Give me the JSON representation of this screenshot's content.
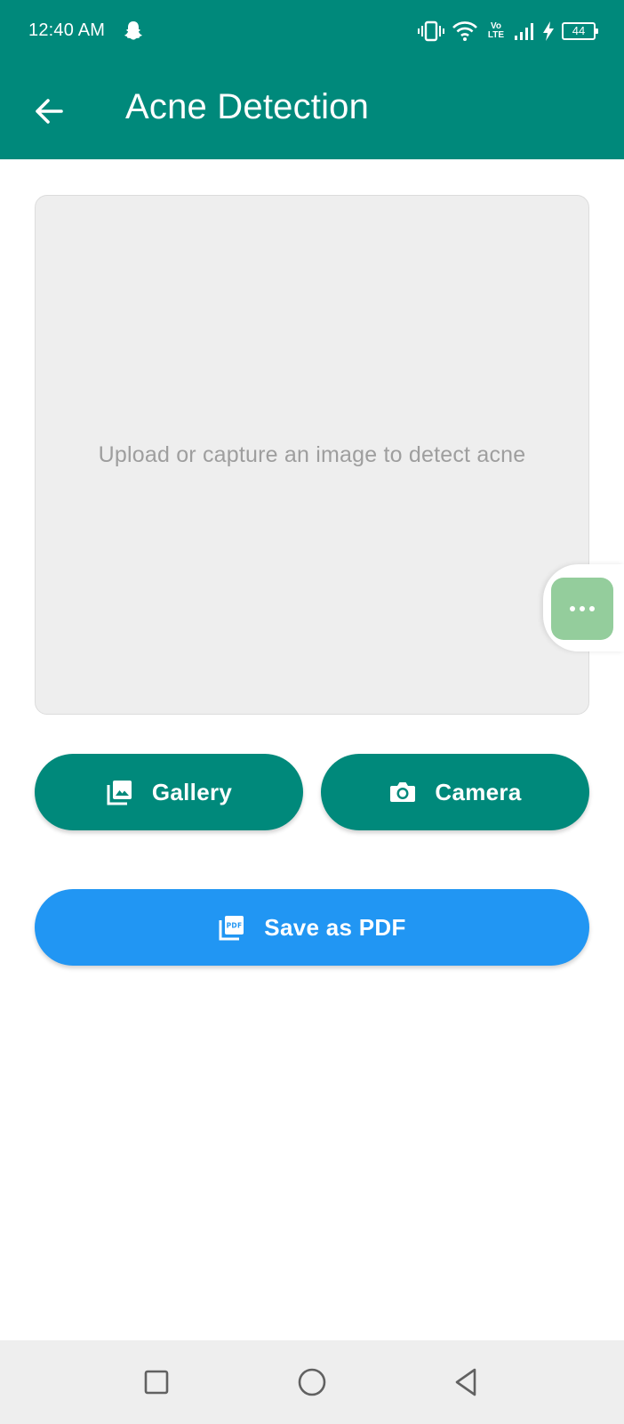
{
  "status_bar": {
    "time": "12:40 AM",
    "battery_level": "44",
    "network_label": "Vo LTE",
    "icons": [
      "snapchat-ghost-icon",
      "vibrate-icon",
      "wifi-icon",
      "volte-icon",
      "signal-icon",
      "charging-icon",
      "battery-icon"
    ]
  },
  "app_bar": {
    "title": "Acne Detection",
    "back_icon": "arrow-left-icon",
    "background_color": "#00897b"
  },
  "image_area": {
    "placeholder": "Upload or capture an image to detect acne"
  },
  "floating_button": {
    "icon": "more-horizontal-icon",
    "color": "#94cd9c"
  },
  "actions": {
    "gallery_label": "Gallery",
    "gallery_icon": "photo-library-icon",
    "camera_label": "Camera",
    "camera_icon": "camera-icon",
    "pdf_label": "Save as PDF",
    "pdf_icon": "pdf-icon",
    "primary_color": "#00897b",
    "pdf_color": "#2196f3"
  },
  "nav_bar": {
    "icons": [
      "recents-square-icon",
      "home-circle-icon",
      "back-triangle-icon"
    ]
  }
}
